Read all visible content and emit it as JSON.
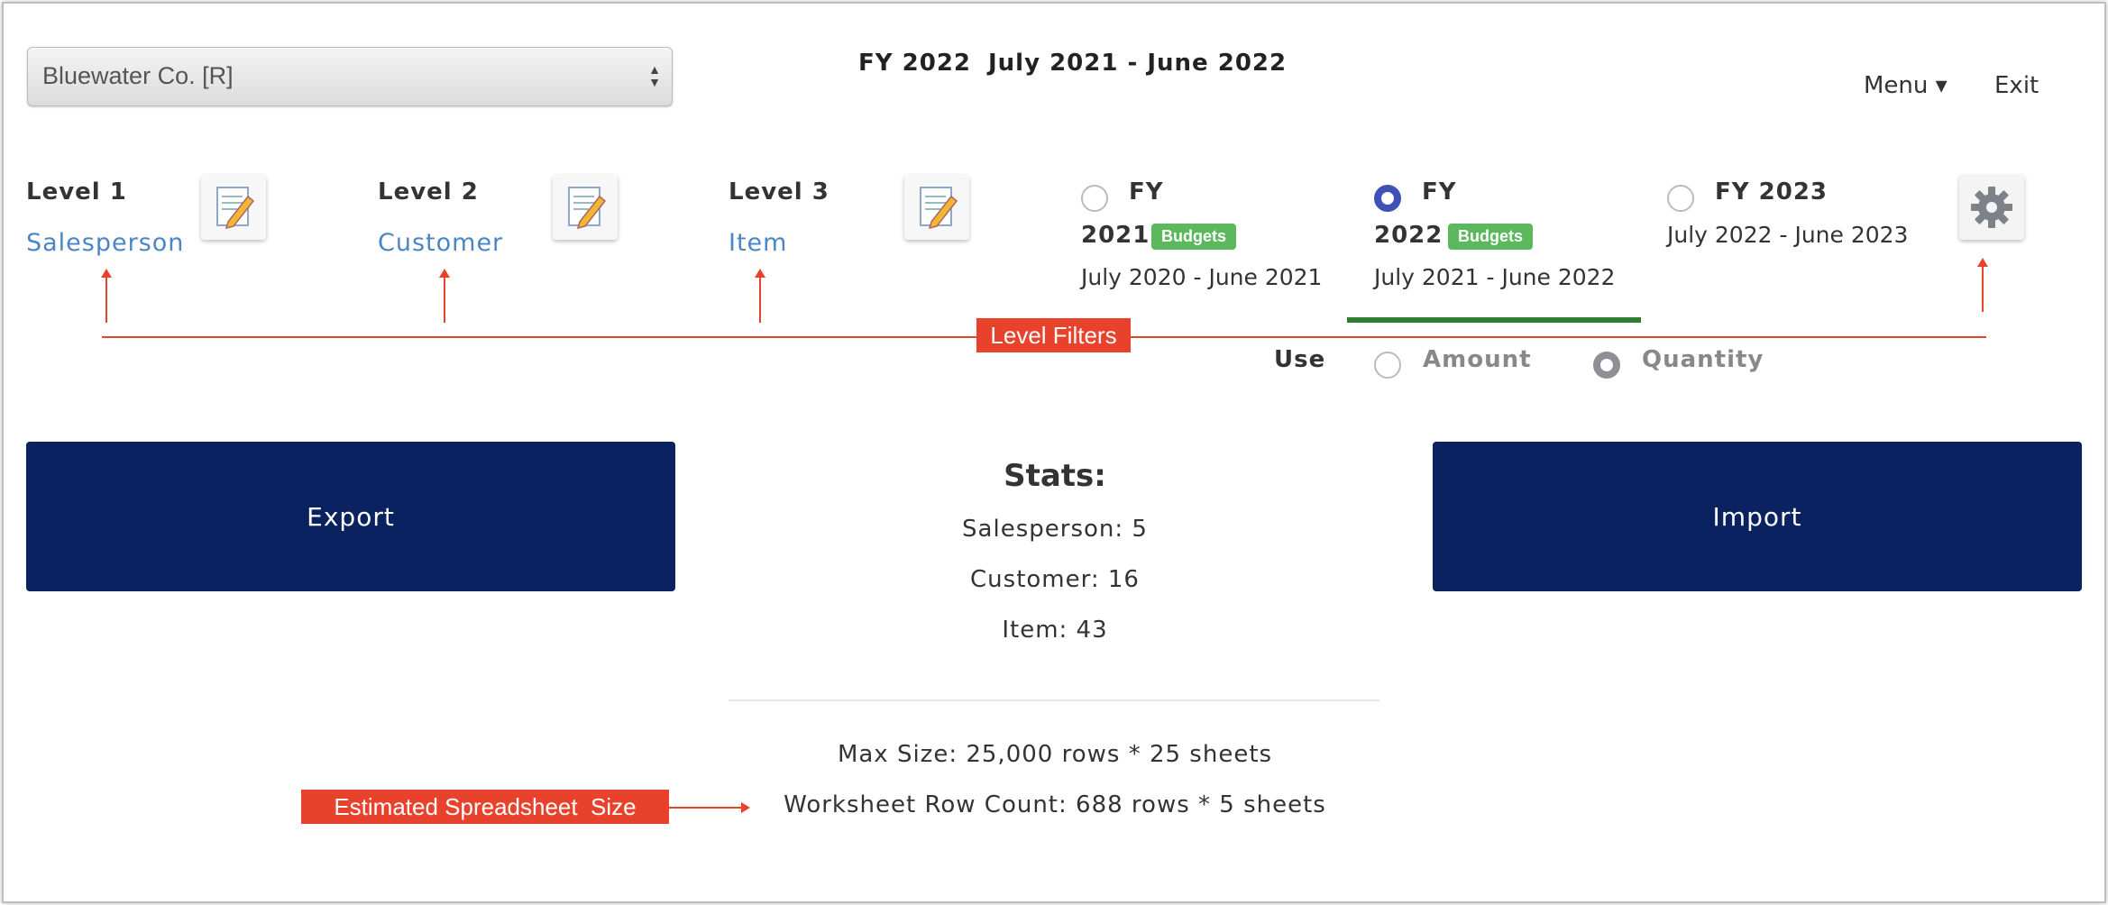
{
  "company_select": {
    "value": "Bluewater Co. [R]"
  },
  "header": {
    "fiscal_year": "FY 2022",
    "period": "July 2021 - June 2022",
    "menu": "Menu ▾",
    "exit": "Exit"
  },
  "levels": [
    {
      "title": "Level 1",
      "value": "Salesperson"
    },
    {
      "title": "Level 2",
      "value": "Customer"
    },
    {
      "title": "Level 3",
      "value": "Item"
    }
  ],
  "fiscal_years": [
    {
      "label_line1": "FY",
      "label_line2": "2021",
      "badge": "Budgets",
      "range": "July 2020 - June 2021",
      "selected": false
    },
    {
      "label_line1": "FY",
      "label_line2": "2022",
      "badge": "Budgets",
      "range": "July 2021 - June 2022",
      "selected": true
    },
    {
      "label_line1": "FY 2023",
      "range": "July 2022 - June 2023",
      "selected": false
    }
  ],
  "use": {
    "label": "Use",
    "options": [
      "Amount",
      "Quantity"
    ],
    "selected": "Quantity"
  },
  "buttons": {
    "export": "Export",
    "import": "Import"
  },
  "stats": {
    "title": "Stats:",
    "salesperson": "Salesperson: 5",
    "customer": "Customer: 16",
    "item": "Item: 43",
    "max_size": "Max Size: 25,000 rows * 25 sheets",
    "row_count": "Worksheet Row Count: 688 rows * 5 sheets"
  },
  "annotations": {
    "level_filters": "Level Filters",
    "estimated_size": "Estimated Spreadsheet  Size"
  },
  "colors": {
    "accent_blue": "#0b2260",
    "link": "#4a86c5",
    "badge": "#5cb85c",
    "callout": "#e8412c",
    "selected_radio": "#3f51b5"
  },
  "icons": [
    "edit-icon",
    "gear-icon",
    "sort-arrows-icon",
    "caret-down-icon"
  ]
}
